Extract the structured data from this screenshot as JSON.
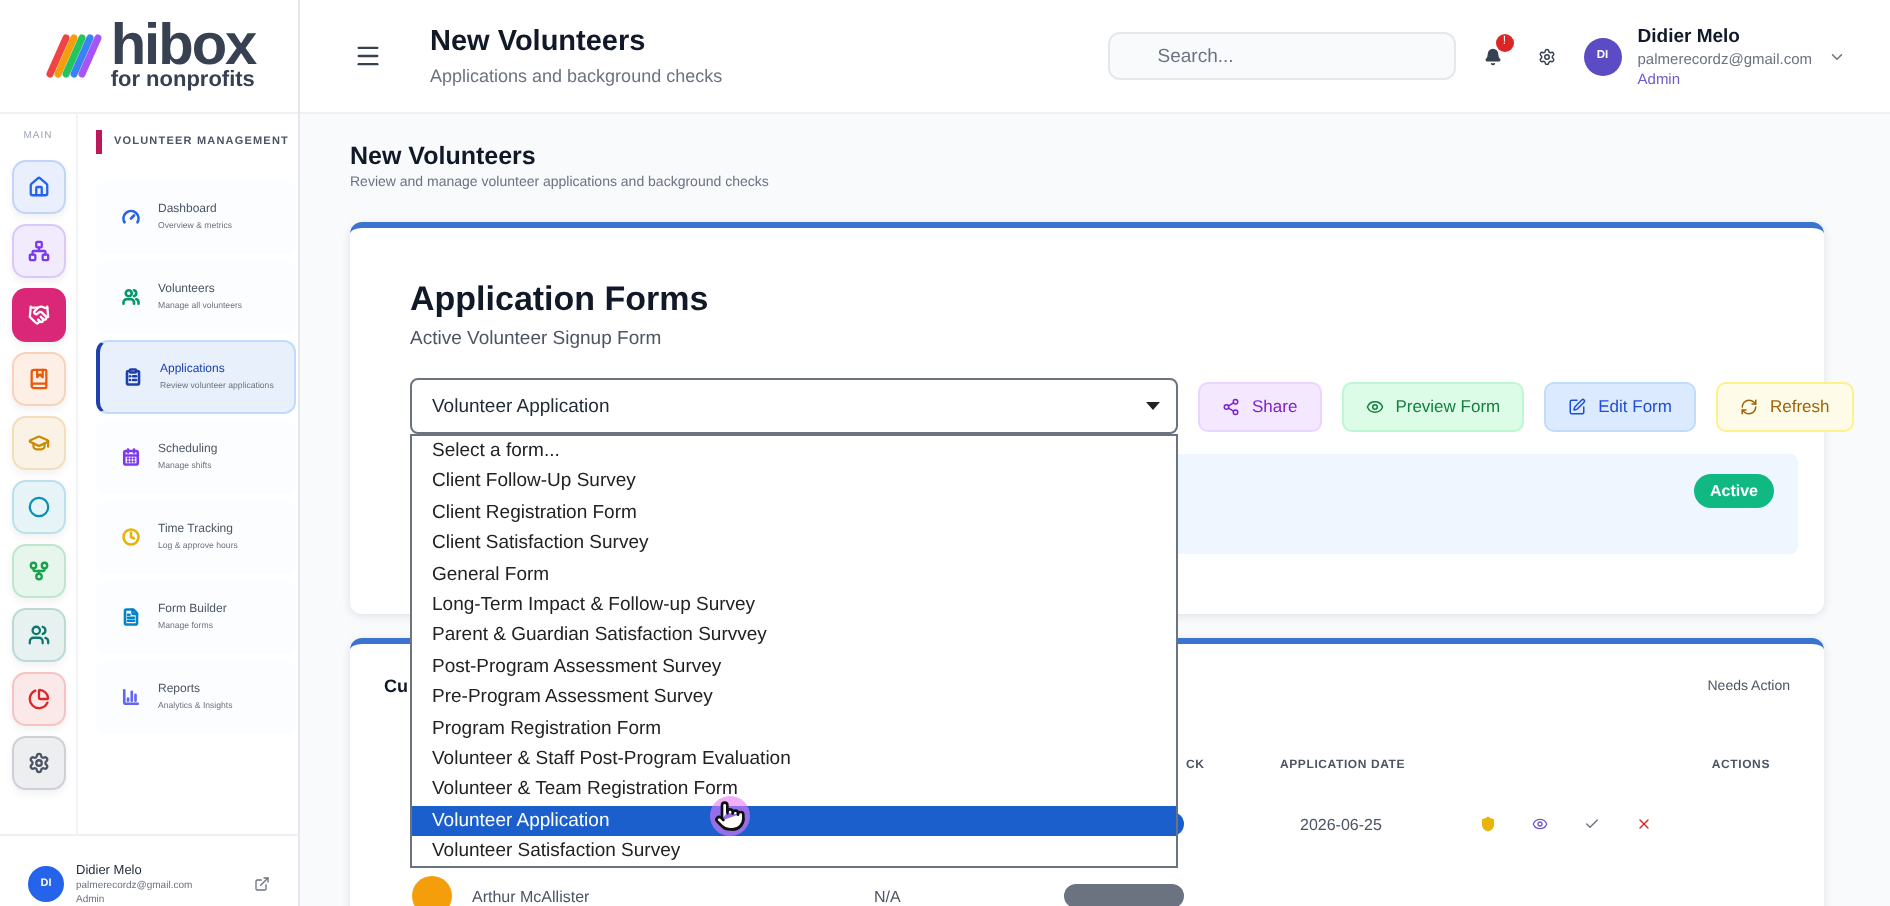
{
  "logo": {
    "name": "hibox",
    "tagline": "for nonprofits"
  },
  "rail": {
    "label": "MAIN",
    "items": [
      {
        "color": "#2563eb",
        "selected": false
      },
      {
        "color": "#7c3aed",
        "selected": false
      },
      {
        "color": "#db2777",
        "selected": true
      },
      {
        "color": "#ea580c",
        "selected": false
      },
      {
        "color": "#ca8a04",
        "selected": false
      },
      {
        "color": "#0891b2",
        "selected": false
      },
      {
        "color": "#16a34a",
        "selected": false
      },
      {
        "color": "#0f766e",
        "selected": false
      },
      {
        "color": "#dc2626",
        "selected": false
      },
      {
        "color": "#4b5563",
        "selected": false
      }
    ]
  },
  "nav": {
    "section": "VOLUNTEER MANAGEMENT",
    "items": [
      {
        "title": "Dashboard",
        "subtitle": "Overview & metrics",
        "color": "#2563eb",
        "selected": false
      },
      {
        "title": "Volunteers",
        "subtitle": "Manage all volunteers",
        "color": "#059669",
        "selected": false
      },
      {
        "title": "Applications",
        "subtitle": "Review volunteer applications",
        "color": "#1e40af",
        "selected": true
      },
      {
        "title": "Scheduling",
        "subtitle": "Manage shifts",
        "color": "#7c3aed",
        "selected": false
      },
      {
        "title": "Time Tracking",
        "subtitle": "Log & approve hours",
        "color": "#eab308",
        "selected": false
      },
      {
        "title": "Form Builder",
        "subtitle": "Manage forms",
        "color": "#0284c7",
        "selected": false
      },
      {
        "title": "Reports",
        "subtitle": "Analytics & Insights",
        "color": "#6366f1",
        "selected": false
      }
    ]
  },
  "sidebar_user": {
    "initials": "DI",
    "name": "Didier Melo",
    "email": "palmerecordz@gmail.com",
    "role": "Admin"
  },
  "header": {
    "title": "New Volunteers",
    "subtitle": "Applications and background checks",
    "search": {
      "placeholder": "Search..."
    },
    "notifications": "!",
    "user": {
      "initials": "DI",
      "name": "Didier Melo",
      "email": "palmerecordz@gmail.com",
      "role": "Admin"
    }
  },
  "page": {
    "title": "New Volunteers",
    "subtitle": "Review and manage volunteer applications and background checks"
  },
  "forms_card": {
    "title": "Application Forms",
    "subtitle": "Active Volunteer Signup Form",
    "select": {
      "value": "Volunteer Application",
      "expanded": true,
      "options": [
        {
          "label": "Select a form...",
          "selected": false
        },
        {
          "label": "Client Follow-Up Survey",
          "selected": false
        },
        {
          "label": "Client Registration Form",
          "selected": false
        },
        {
          "label": "Client Satisfaction Survey",
          "selected": false
        },
        {
          "label": "General Form",
          "selected": false
        },
        {
          "label": "Long-Term Impact & Follow-up Survey",
          "selected": false
        },
        {
          "label": "Parent & Guardian Satisfaction Survvey",
          "selected": false
        },
        {
          "label": "Post-Program Assessment Survey",
          "selected": false
        },
        {
          "label": "Pre-Program Assessment Survey",
          "selected": false
        },
        {
          "label": "Program Registration Form",
          "selected": false
        },
        {
          "label": "Volunteer & Staff Post-Program Evaluation",
          "selected": false
        },
        {
          "label": "Volunteer & Team Registration Form",
          "selected": false
        },
        {
          "label": "Volunteer Application",
          "selected": true
        },
        {
          "label": "Volunteer Satisfaction Survey",
          "selected": false
        }
      ]
    },
    "buttons": [
      {
        "label": "Share",
        "kind": "share"
      },
      {
        "label": "Preview Form",
        "kind": "preview"
      },
      {
        "label": "Edit Form",
        "kind": "edit"
      },
      {
        "label": "Refresh",
        "kind": "refresh"
      }
    ],
    "status": "Active"
  },
  "applications_card": {
    "title": "Cu",
    "filter": "Needs Action",
    "columns": [
      "CK",
      "APPLICATION DATE",
      "ACTIONS"
    ],
    "rows": [
      {
        "date": "2026-06-25"
      },
      {
        "name": "Arthur McAllister",
        "column_2": "N/A"
      }
    ]
  }
}
